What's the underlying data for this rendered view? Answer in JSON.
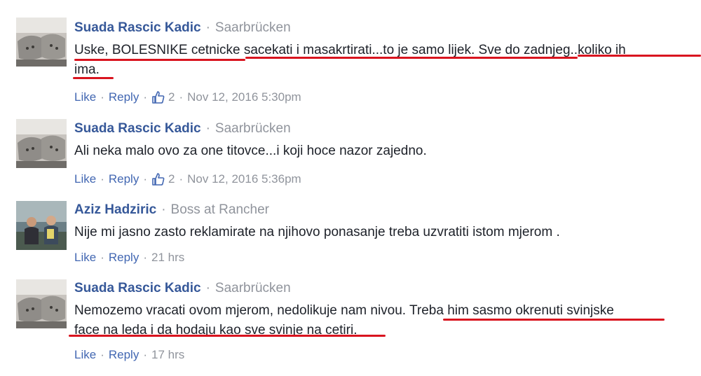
{
  "comments": [
    {
      "author": "Suada Rascic Kadic",
      "meta": "Saarbrücken",
      "text_line1": "Uske, BOLESNIKE cetnicke sacekati i masakrtirati...to je samo lijek. Sve do zadnjeg..koliko ih",
      "text_line2": "ima.",
      "like": "Like",
      "reply": "Reply",
      "reactions": "2",
      "time": "Nov 12, 2016 5:30pm"
    },
    {
      "author": "Suada Rascic Kadic",
      "meta": "Saarbrücken",
      "text_line1": "Ali neka malo ovo za one titovce...i koji hoce nazor zajedno.",
      "like": "Like",
      "reply": "Reply",
      "reactions": "2",
      "time": "Nov 12, 2016 5:36pm"
    },
    {
      "author": "Aziz Hadziric",
      "meta": "Boss at Rancher",
      "text_line1": "Nije mi jasno zasto reklamirate na njihovo ponasanje treba uzvratiti istom mjerom .",
      "like": "Like",
      "reply": "Reply",
      "time": "21 hrs"
    },
    {
      "author": "Suada Rascic Kadic",
      "meta": "Saarbrücken",
      "text_line1a": "Nemozemo vracati ovom mjerom, nedolikuje nam nivou. ",
      "text_line1b": "Treba him sasmo okrenuti svinjske",
      "text_line2": "face na leda i da hodaju kao sve svinje na cetiri.",
      "like": "Like",
      "reply": "Reply",
      "time": "17 hrs"
    }
  ],
  "icons": {
    "reaction": "thumbs-up-icon"
  },
  "colors": {
    "author": "#365899",
    "link": "#4267b2",
    "meta": "#90949c",
    "underline": "#d9141f"
  }
}
